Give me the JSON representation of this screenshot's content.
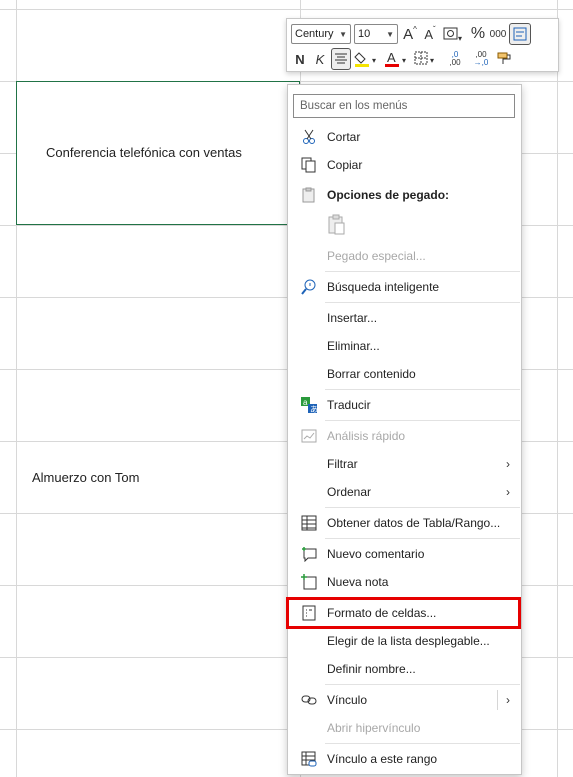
{
  "sheet": {
    "cell_meeting": "Conferencia telefónica con ventas",
    "cell_lunch": "Almuerzo con Tom",
    "accent_color": "#217346"
  },
  "toolbar": {
    "font_name": "Century",
    "font_size": "10",
    "grow_font": "A",
    "shrink_font": "A",
    "percent": "%",
    "thousands": "000",
    "bold": "N",
    "italic": "K",
    "inc_decimal_top": ",0",
    "inc_decimal_bottom": ",00",
    "dec_decimal_top": ",00",
    "dec_decimal_bottom": "→,0"
  },
  "menu": {
    "search_placeholder": "Buscar en los menús",
    "items": [
      {
        "label": "Cortar",
        "icon": "scissors-icon"
      },
      {
        "label": "Copiar",
        "icon": "copy-icon"
      },
      {
        "label": "Opciones de pegado:",
        "icon": "paste-options-icon"
      },
      {
        "label": "Pegado especial...",
        "icon": ""
      },
      {
        "label": "Búsqueda inteligente",
        "icon": "smart-lookup-icon"
      },
      {
        "label": "Insertar...",
        "icon": ""
      },
      {
        "label": "Eliminar...",
        "icon": ""
      },
      {
        "label": "Borrar contenido",
        "icon": ""
      },
      {
        "label": "Traducir",
        "icon": "translate-icon"
      },
      {
        "label": "Análisis rápido",
        "icon": "quick-analysis-icon"
      },
      {
        "label": "Filtrar",
        "icon": ""
      },
      {
        "label": "Ordenar",
        "icon": ""
      },
      {
        "label": "Obtener datos de Tabla/Rango...",
        "icon": "table-icon"
      },
      {
        "label": "Nuevo comentario",
        "icon": "comment-icon"
      },
      {
        "label": "Nueva nota",
        "icon": "note-icon"
      },
      {
        "label": "Formato de celdas...",
        "icon": "format-cells-icon"
      },
      {
        "label": "Elegir de la lista desplegable...",
        "icon": ""
      },
      {
        "label": "Definir nombre...",
        "icon": ""
      },
      {
        "label": "Vínculo",
        "icon": "link-icon"
      },
      {
        "label": "Abrir hipervínculo",
        "icon": ""
      },
      {
        "label": "Vínculo a este rango",
        "icon": "link-range-icon"
      }
    ],
    "submenu_arrow": "›",
    "highlight_color": "#e60000"
  }
}
